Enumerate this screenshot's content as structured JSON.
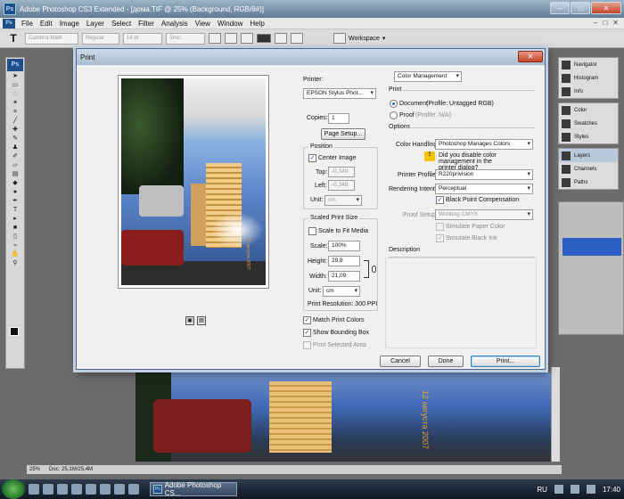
{
  "app": {
    "title": "Adobe Photoshop CS3 Extended - [дома.TIF @ 25% (Background, RGB/8#)]",
    "logo": "Ps",
    "window_buttons": [
      "–",
      "□",
      "✕"
    ]
  },
  "menubar": {
    "items": [
      "File",
      "Edit",
      "Image",
      "Layer",
      "Select",
      "Filter",
      "Analysis",
      "View",
      "Window",
      "Help"
    ],
    "right": [
      "–",
      "□",
      "✕"
    ]
  },
  "options_bar": {
    "tool_glyph": "T",
    "font_family": "Cambria Math",
    "font_style": "Regular",
    "font_size": "18 pt",
    "antialias": "Smo...",
    "workspace": "Workspace"
  },
  "status_bar": {
    "zoom": "25%",
    "doc_info": "Doc: 25,1M/25,4M"
  },
  "document": {
    "photo_date": "12 августа 2007"
  },
  "panels": {
    "group1": [
      "Navigator",
      "Histogram",
      "Info"
    ],
    "group2": [
      "Color",
      "Swatches",
      "Styles"
    ],
    "group3": [
      "Layers",
      "Channels",
      "Paths"
    ]
  },
  "taskbar": {
    "task_label": "Adobe Photoshop CS...",
    "language": "RU",
    "time": "17:40"
  },
  "dialog": {
    "title": "Print",
    "close_glyph": "✕",
    "printer_label": "Printer:",
    "printer_value": "EPSON Stylus Phot...",
    "copies_label": "Copies:",
    "copies_value": "1",
    "page_setup": "Page Setup...",
    "position": {
      "title": "Position",
      "center_image": "Center Image",
      "center_checked": "✓",
      "top_label": "Top:",
      "top_value": "-0,349",
      "left_label": "Left:",
      "left_value": "-0,349",
      "unit_label": "Unit:",
      "unit_value": "cm"
    },
    "scaled": {
      "title": "Scaled Print Size",
      "scale_to_fit": "Scale to Fit Media",
      "scale_label": "Scale:",
      "scale_value": "100%",
      "height_label": "Height:",
      "height_value": "29,8",
      "width_label": "Width:",
      "width_value": "21,09",
      "unit_label": "Unit:",
      "unit_value": "cm",
      "resolution": "Print Resolution: 300 PPI"
    },
    "match_print_colors": "Match Print Colors",
    "match_checked": "✓",
    "show_bounding_box": "Show Bounding Box",
    "bbox_checked": "✓",
    "print_selected_area": "Print Selected Area",
    "color_management": {
      "dropdown": "Color Management",
      "print_heading": "Print",
      "document_label": "Document",
      "document_profile": "(Profile: Untagged RGB)",
      "proof_label": "Proof",
      "proof_profile": "(Profile: N/A)",
      "options_heading": "Options",
      "color_handling_label": "Color Handling:",
      "color_handling_value": "Photoshop Manages Colors",
      "notice": "Did you disable color management in the printer dialog?",
      "notice_icon": "!",
      "printer_profile_label": "Printer Profile:",
      "printer_profile_value": "R220privision",
      "rendering_intent_label": "Rendering Intent:",
      "rendering_intent_value": "Perceptual",
      "black_point": "Black Point Compensation",
      "black_point_checked": "✓",
      "proof_setup_label": "Proof Setup:",
      "proof_setup_value": "Working CMYK",
      "simulate_paper": "Simulate Paper Color",
      "simulate_ink": "Simulate Black Ink",
      "simulate_ink_checked": "✓",
      "description_heading": "Description"
    },
    "buttons": {
      "cancel": "Cancel",
      "done": "Done",
      "print": "Print..."
    }
  }
}
